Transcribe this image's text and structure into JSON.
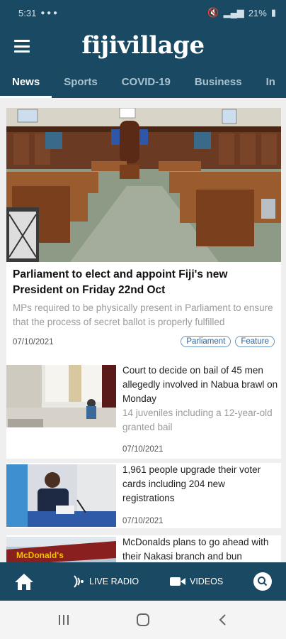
{
  "status_bar": {
    "time": "5:31",
    "battery": "21%"
  },
  "header": {
    "logo": "fijivillage"
  },
  "tabs": [
    "News",
    "Sports",
    "COVID-19",
    "Business",
    "In"
  ],
  "featured": {
    "title": "Parliament to elect and appoint Fiji's new President on Friday 22nd Oct",
    "subtitle": "MPs required to be physically present in Parliament to ensure that the process of secret ballot is properly fulfilled",
    "date": "07/10/2021",
    "tags": [
      "Parliament",
      "Feature"
    ]
  },
  "articles": [
    {
      "title": "Court to decide on bail of 45 men allegedly involved in Nabua brawl on Monday",
      "subtitle": "14 juveniles including a 12-year-old granted bail",
      "date": "07/10/2021"
    },
    {
      "title": "1,961 people upgrade their voter cards including 204 new registrations",
      "subtitle": "",
      "date": "07/10/2021"
    },
    {
      "title": "McDonalds plans to go ahead with their Nakasi branch and bun",
      "subtitle": "",
      "date": "",
      "thumb_sign": "McDonald's"
    }
  ],
  "bottom_nav": {
    "live_radio": "LIVE RADIO",
    "videos": "VIDEOS"
  },
  "colors": {
    "primary": "#1a4a63",
    "tag_border": "#6a93be",
    "tag_text": "#2f5f92"
  }
}
